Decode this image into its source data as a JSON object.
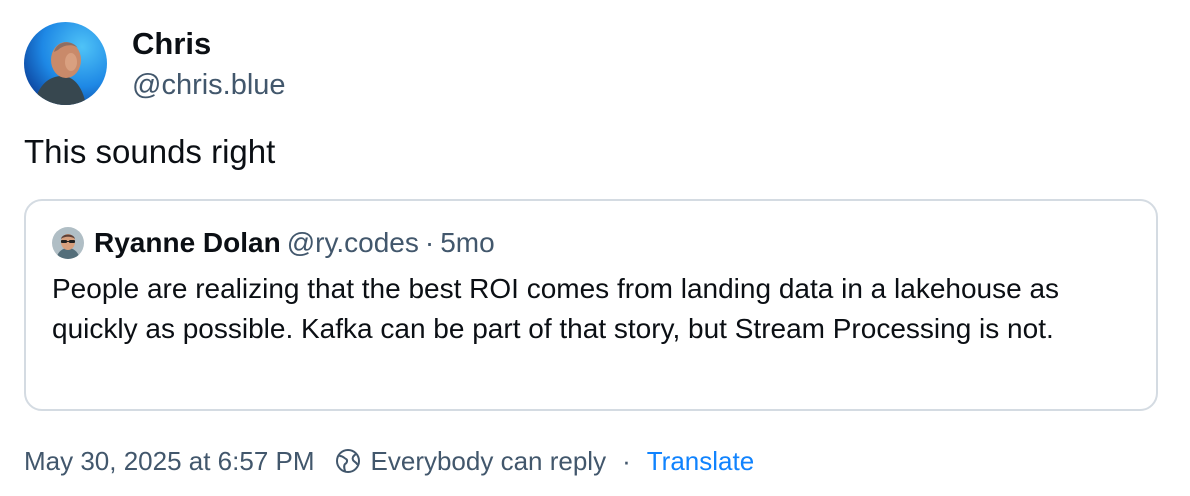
{
  "post": {
    "author": {
      "display_name": "Chris",
      "handle": "@chris.blue"
    },
    "text": "This sounds right",
    "quote": {
      "author_name": "Ryanne Dolan",
      "author_handle": "@ry.codes",
      "separator": "·",
      "age": "5mo",
      "text": "People are realizing that the best ROI comes from landing data in a lakehouse as quickly as possible. Kafka can be part of that story, but Stream Processing is not."
    },
    "footer": {
      "timestamp": "May 30, 2025 at 6:57 PM",
      "reply_setting": "Everybody can reply",
      "separator": "·",
      "translate_label": "Translate"
    }
  },
  "icons": {
    "reply_setting_icon": "globe-earth-icon"
  },
  "colors": {
    "text_primary": "#0b0f14",
    "text_secondary": "#42576c",
    "link": "#1083fe",
    "card_border": "#d4dbe2"
  }
}
